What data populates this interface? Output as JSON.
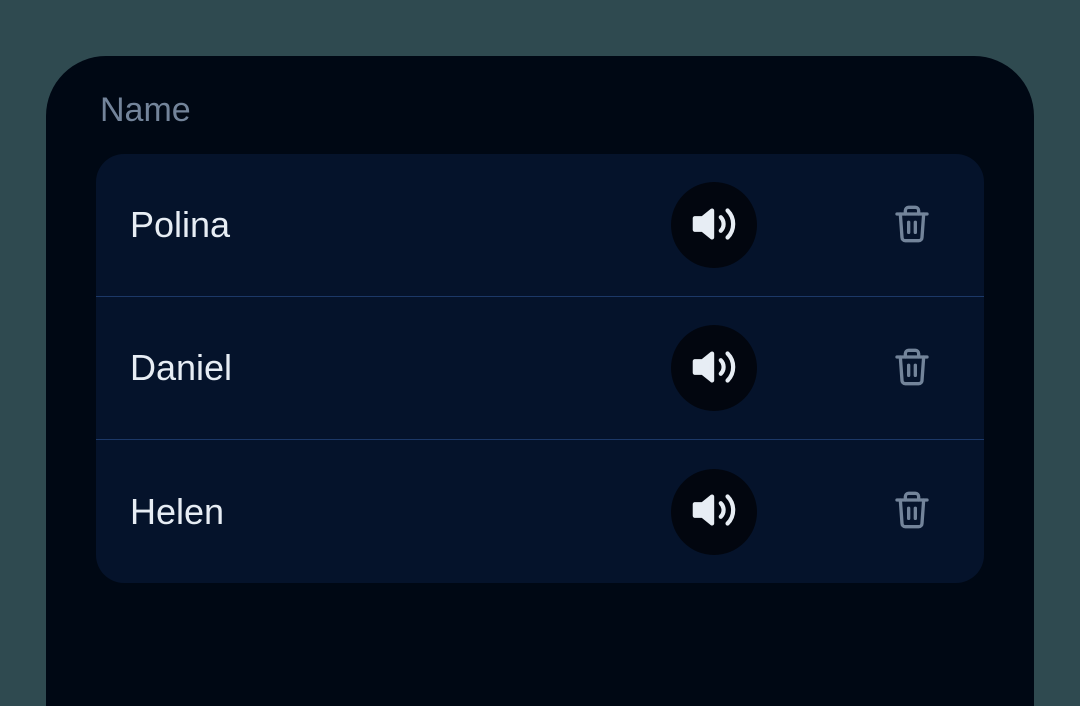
{
  "header": {
    "label": "Name"
  },
  "rows": [
    {
      "name": "Polina"
    },
    {
      "name": "Daniel"
    },
    {
      "name": "Helen"
    }
  ]
}
